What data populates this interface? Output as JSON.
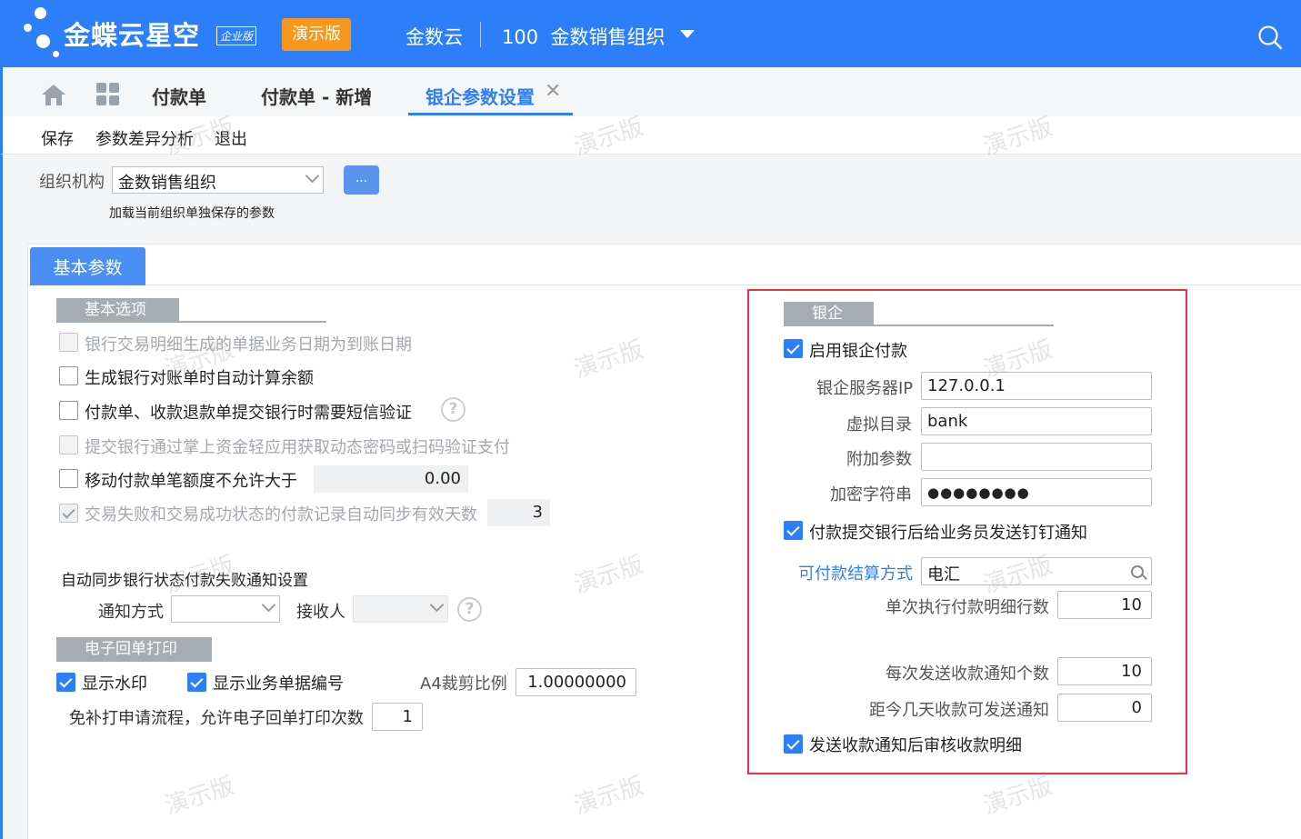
{
  "header": {
    "logo_text": "金蝶云星空",
    "edition": "企业版",
    "demo_badge": "演示版",
    "brand": "金数云",
    "org_code": "100",
    "org_name": "金数销售组织"
  },
  "tabs": [
    {
      "label": "付款单"
    },
    {
      "label": "付款单 - 新增"
    },
    {
      "label": "银企参数设置"
    }
  ],
  "toolbar": {
    "save": "保存",
    "diff": "参数差异分析",
    "exit": "退出"
  },
  "org_field": {
    "label": "组织机构",
    "value": "金数销售组织",
    "dots": "...",
    "note": "加载当前组织单独保存的参数"
  },
  "panel_tab": "基本参数",
  "basic": {
    "head": "基本选项",
    "opt1": "银行交易明细生成的单据业务日期为到账日期",
    "opt2": "生成银行对账单时自动计算余额",
    "opt3": "付款单、收款退款单提交银行时需要短信验证",
    "opt4": "提交银行通过掌上资金轻应用获取动态密码或扫码验证支付",
    "opt5": "移动付款单笔额度不允许大于",
    "opt5_value": "0.00",
    "opt6": "交易失败和交易成功状态的付款记录自动同步有效天数",
    "opt6_value": "3",
    "help": "?"
  },
  "notify": {
    "title": "自动同步银行状态付款失败通知设置",
    "method_label": "通知方式",
    "receiver_label": "接收人"
  },
  "eprint": {
    "head": "电子回单打印",
    "watermark": "显示水印",
    "show_bill_no": "显示业务单据编号",
    "a4_label": "A4裁剪比例",
    "a4_value": "1.00000000",
    "times_label": "免补打申请流程，允许电子回单打印次数",
    "times_value": "1"
  },
  "bank": {
    "head": "银企",
    "enable": "启用银企付款",
    "ip_label": "银企服务器IP",
    "ip_value": "127.0.0.1",
    "dir_label": "虚拟目录",
    "dir_value": "bank",
    "extra_label": "附加参数",
    "extra_value": "",
    "secret_label": "加密字符串",
    "secret_value": "●●●●●●●●",
    "dingtalk": "付款提交银行后给业务员发送钉钉通知",
    "settle_label": "可付款结算方式",
    "settle_value": "电汇",
    "rows_label": "单次执行付款明细行数",
    "rows_value": "10",
    "per_send_label": "每次发送收款通知个数",
    "per_send_value": "10",
    "days_label": "距今几天收款可发送通知",
    "days_value": "0",
    "audit": "发送收款通知后审核收款明细"
  },
  "watermark_text": "演示版"
}
